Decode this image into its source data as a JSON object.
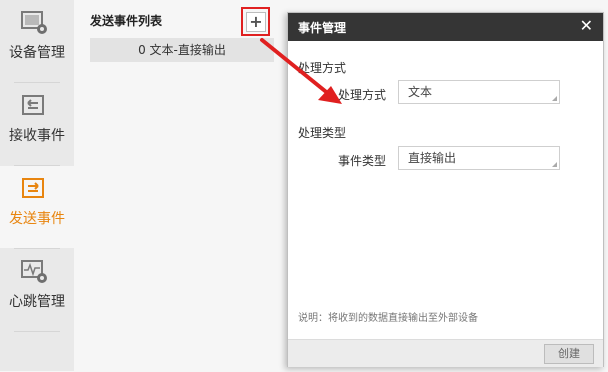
{
  "nav": {
    "items": [
      {
        "label": "设备管理",
        "icon": "device-settings-icon"
      },
      {
        "label": "接收事件",
        "icon": "receive-event-icon"
      },
      {
        "label": "发送事件",
        "icon": "send-event-icon"
      },
      {
        "label": "心跳管理",
        "icon": "heartbeat-settings-icon"
      }
    ],
    "active": "发送事件"
  },
  "event_list": {
    "title": "发送事件列表",
    "add_label": "+",
    "items": [
      "0 文本-直接输出"
    ]
  },
  "dialog": {
    "title": "事件管理",
    "close_label": "✕",
    "section1": "处理方式",
    "field1_label": "处理方式",
    "field1_value": "文本",
    "section2": "处理类型",
    "field2_label": "事件类型",
    "field2_value": "直接输出",
    "hint": "说明：将收到的数据直接输出至外部设备",
    "create_label": "创建"
  },
  "colors": {
    "accent": "#e8850f",
    "header": "#353535",
    "annotation": "#e02020"
  }
}
